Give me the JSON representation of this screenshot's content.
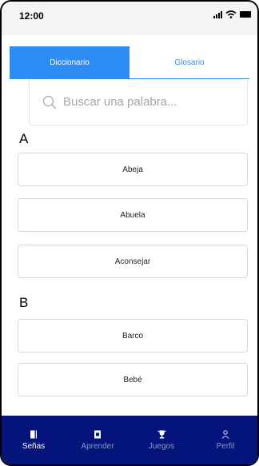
{
  "status_bar": {
    "time": "12:00"
  },
  "tabs": [
    {
      "label": "Diccionario",
      "active": true
    },
    {
      "label": "Glosario",
      "active": false
    }
  ],
  "search": {
    "placeholder": "Buscar una palabra..."
  },
  "sections": [
    {
      "letter": "A",
      "words": [
        "Abeja",
        "Abuela",
        "Aconsejar"
      ]
    },
    {
      "letter": "B",
      "words": [
        "Barco",
        "Bebé"
      ]
    }
  ],
  "nav": {
    "items": [
      {
        "label": "Señas",
        "icon": "book-icon",
        "active": true
      },
      {
        "label": "Aprender",
        "icon": "learn-icon",
        "active": false
      },
      {
        "label": "Juegos",
        "icon": "trophy-icon",
        "active": false
      },
      {
        "label": "Perfil",
        "icon": "person-icon",
        "active": false
      }
    ]
  },
  "colors": {
    "accent": "#2e8df4",
    "nav_background": "#05147a",
    "nav_inactive": "#8d96c6"
  }
}
